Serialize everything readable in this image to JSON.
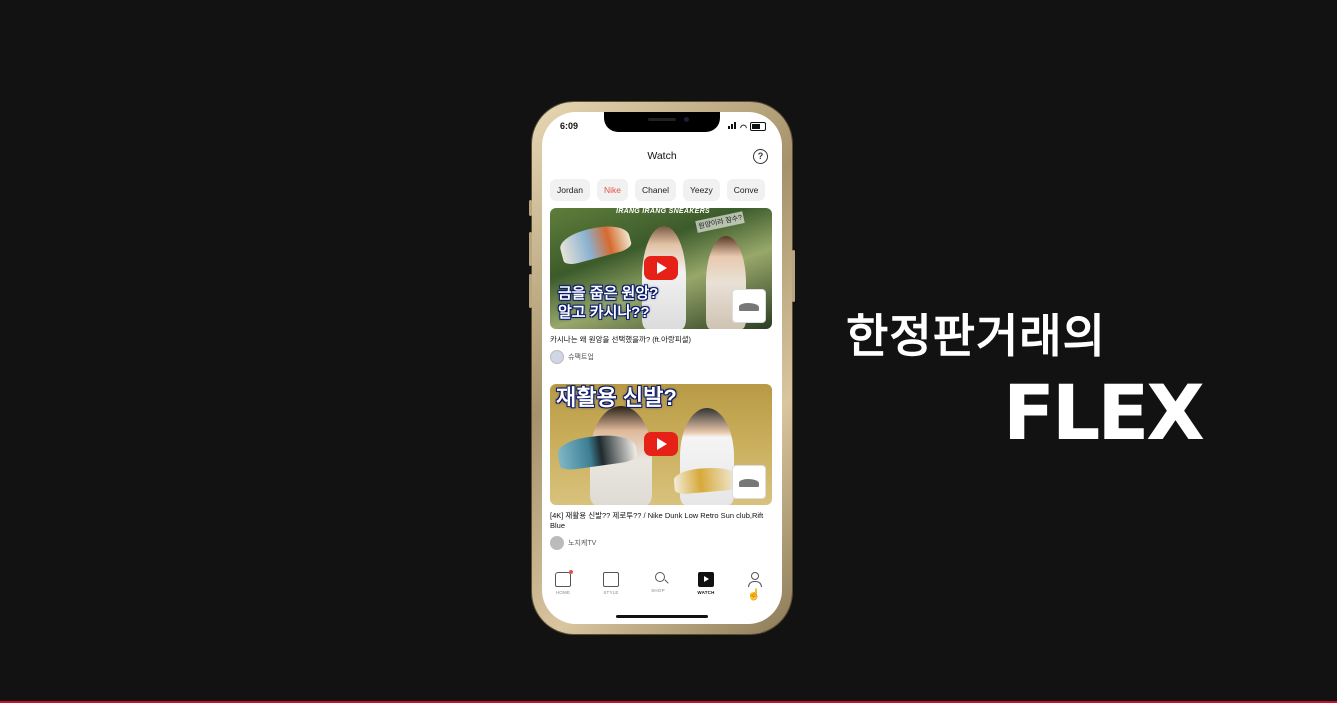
{
  "status_bar": {
    "time": "6:09"
  },
  "header": {
    "title": "Watch",
    "help_symbol": "?"
  },
  "chips": [
    {
      "label": "Jordan",
      "active": false
    },
    {
      "label": "Nike",
      "active": true
    },
    {
      "label": "Chanel",
      "active": false
    },
    {
      "label": "Yeezy",
      "active": false
    },
    {
      "label": "Conve",
      "active": false
    }
  ],
  "videos": [
    {
      "thumb_banner": "IRANG IRANG SNEAKERS",
      "thumb_handwriting": "원양이라 잠수?",
      "thumb_title_line1": "금을 줍은 원앙?",
      "thumb_title_line2": "알고 카시나??",
      "caption": "카시나는 왜 원앙을 선택했을까? (ft.아랑피셜)",
      "channel": "슈팩트업"
    },
    {
      "thumb_title_line1": "재활용 신발?",
      "caption": "[4K] 재활용 신발?? 제로투?? / Nike Dunk Low Retro Sun club,Rift Blue",
      "channel": "노지케TV"
    }
  ],
  "tabbar": [
    {
      "label": "HOME",
      "icon": "home-icon",
      "active": false,
      "badge": true
    },
    {
      "label": "STYLE",
      "icon": "style-icon",
      "active": false
    },
    {
      "label": "SHOP",
      "icon": "shop-icon",
      "active": false
    },
    {
      "label": "WATCH",
      "icon": "watch-icon",
      "active": true
    },
    {
      "label": "",
      "icon": "profile-icon",
      "active": false
    }
  ],
  "promo": {
    "tagline": "한정판거래의",
    "headline": "FLEX"
  },
  "colors": {
    "accent": "#e0554d",
    "play": "#e62117",
    "background": "#121212"
  }
}
